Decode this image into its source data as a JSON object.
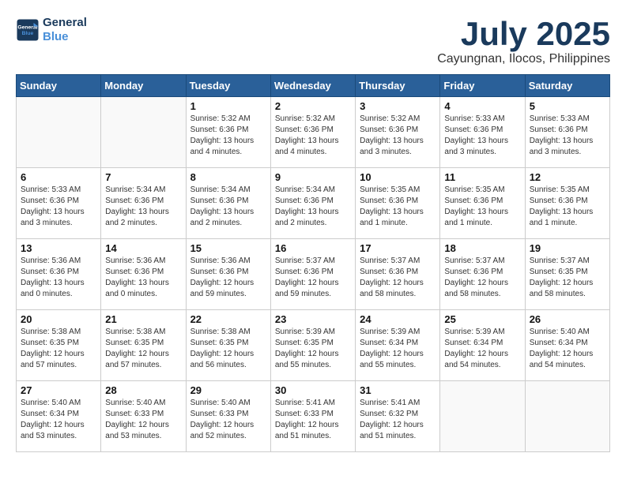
{
  "header": {
    "logo_line1": "General",
    "logo_line2": "Blue",
    "month": "July 2025",
    "location": "Cayungnan, Ilocos, Philippines"
  },
  "weekdays": [
    "Sunday",
    "Monday",
    "Tuesday",
    "Wednesday",
    "Thursday",
    "Friday",
    "Saturday"
  ],
  "weeks": [
    [
      {
        "day": "",
        "info": ""
      },
      {
        "day": "",
        "info": ""
      },
      {
        "day": "1",
        "info": "Sunrise: 5:32 AM\nSunset: 6:36 PM\nDaylight: 13 hours\nand 4 minutes."
      },
      {
        "day": "2",
        "info": "Sunrise: 5:32 AM\nSunset: 6:36 PM\nDaylight: 13 hours\nand 4 minutes."
      },
      {
        "day": "3",
        "info": "Sunrise: 5:32 AM\nSunset: 6:36 PM\nDaylight: 13 hours\nand 3 minutes."
      },
      {
        "day": "4",
        "info": "Sunrise: 5:33 AM\nSunset: 6:36 PM\nDaylight: 13 hours\nand 3 minutes."
      },
      {
        "day": "5",
        "info": "Sunrise: 5:33 AM\nSunset: 6:36 PM\nDaylight: 13 hours\nand 3 minutes."
      }
    ],
    [
      {
        "day": "6",
        "info": "Sunrise: 5:33 AM\nSunset: 6:36 PM\nDaylight: 13 hours\nand 3 minutes."
      },
      {
        "day": "7",
        "info": "Sunrise: 5:34 AM\nSunset: 6:36 PM\nDaylight: 13 hours\nand 2 minutes."
      },
      {
        "day": "8",
        "info": "Sunrise: 5:34 AM\nSunset: 6:36 PM\nDaylight: 13 hours\nand 2 minutes."
      },
      {
        "day": "9",
        "info": "Sunrise: 5:34 AM\nSunset: 6:36 PM\nDaylight: 13 hours\nand 2 minutes."
      },
      {
        "day": "10",
        "info": "Sunrise: 5:35 AM\nSunset: 6:36 PM\nDaylight: 13 hours\nand 1 minute."
      },
      {
        "day": "11",
        "info": "Sunrise: 5:35 AM\nSunset: 6:36 PM\nDaylight: 13 hours\nand 1 minute."
      },
      {
        "day": "12",
        "info": "Sunrise: 5:35 AM\nSunset: 6:36 PM\nDaylight: 13 hours\nand 1 minute."
      }
    ],
    [
      {
        "day": "13",
        "info": "Sunrise: 5:36 AM\nSunset: 6:36 PM\nDaylight: 13 hours\nand 0 minutes."
      },
      {
        "day": "14",
        "info": "Sunrise: 5:36 AM\nSunset: 6:36 PM\nDaylight: 13 hours\nand 0 minutes."
      },
      {
        "day": "15",
        "info": "Sunrise: 5:36 AM\nSunset: 6:36 PM\nDaylight: 12 hours\nand 59 minutes."
      },
      {
        "day": "16",
        "info": "Sunrise: 5:37 AM\nSunset: 6:36 PM\nDaylight: 12 hours\nand 59 minutes."
      },
      {
        "day": "17",
        "info": "Sunrise: 5:37 AM\nSunset: 6:36 PM\nDaylight: 12 hours\nand 58 minutes."
      },
      {
        "day": "18",
        "info": "Sunrise: 5:37 AM\nSunset: 6:36 PM\nDaylight: 12 hours\nand 58 minutes."
      },
      {
        "day": "19",
        "info": "Sunrise: 5:37 AM\nSunset: 6:35 PM\nDaylight: 12 hours\nand 58 minutes."
      }
    ],
    [
      {
        "day": "20",
        "info": "Sunrise: 5:38 AM\nSunset: 6:35 PM\nDaylight: 12 hours\nand 57 minutes."
      },
      {
        "day": "21",
        "info": "Sunrise: 5:38 AM\nSunset: 6:35 PM\nDaylight: 12 hours\nand 57 minutes."
      },
      {
        "day": "22",
        "info": "Sunrise: 5:38 AM\nSunset: 6:35 PM\nDaylight: 12 hours\nand 56 minutes."
      },
      {
        "day": "23",
        "info": "Sunrise: 5:39 AM\nSunset: 6:35 PM\nDaylight: 12 hours\nand 55 minutes."
      },
      {
        "day": "24",
        "info": "Sunrise: 5:39 AM\nSunset: 6:34 PM\nDaylight: 12 hours\nand 55 minutes."
      },
      {
        "day": "25",
        "info": "Sunrise: 5:39 AM\nSunset: 6:34 PM\nDaylight: 12 hours\nand 54 minutes."
      },
      {
        "day": "26",
        "info": "Sunrise: 5:40 AM\nSunset: 6:34 PM\nDaylight: 12 hours\nand 54 minutes."
      }
    ],
    [
      {
        "day": "27",
        "info": "Sunrise: 5:40 AM\nSunset: 6:34 PM\nDaylight: 12 hours\nand 53 minutes."
      },
      {
        "day": "28",
        "info": "Sunrise: 5:40 AM\nSunset: 6:33 PM\nDaylight: 12 hours\nand 53 minutes."
      },
      {
        "day": "29",
        "info": "Sunrise: 5:40 AM\nSunset: 6:33 PM\nDaylight: 12 hours\nand 52 minutes."
      },
      {
        "day": "30",
        "info": "Sunrise: 5:41 AM\nSunset: 6:33 PM\nDaylight: 12 hours\nand 51 minutes."
      },
      {
        "day": "31",
        "info": "Sunrise: 5:41 AM\nSunset: 6:32 PM\nDaylight: 12 hours\nand 51 minutes."
      },
      {
        "day": "",
        "info": ""
      },
      {
        "day": "",
        "info": ""
      }
    ]
  ]
}
